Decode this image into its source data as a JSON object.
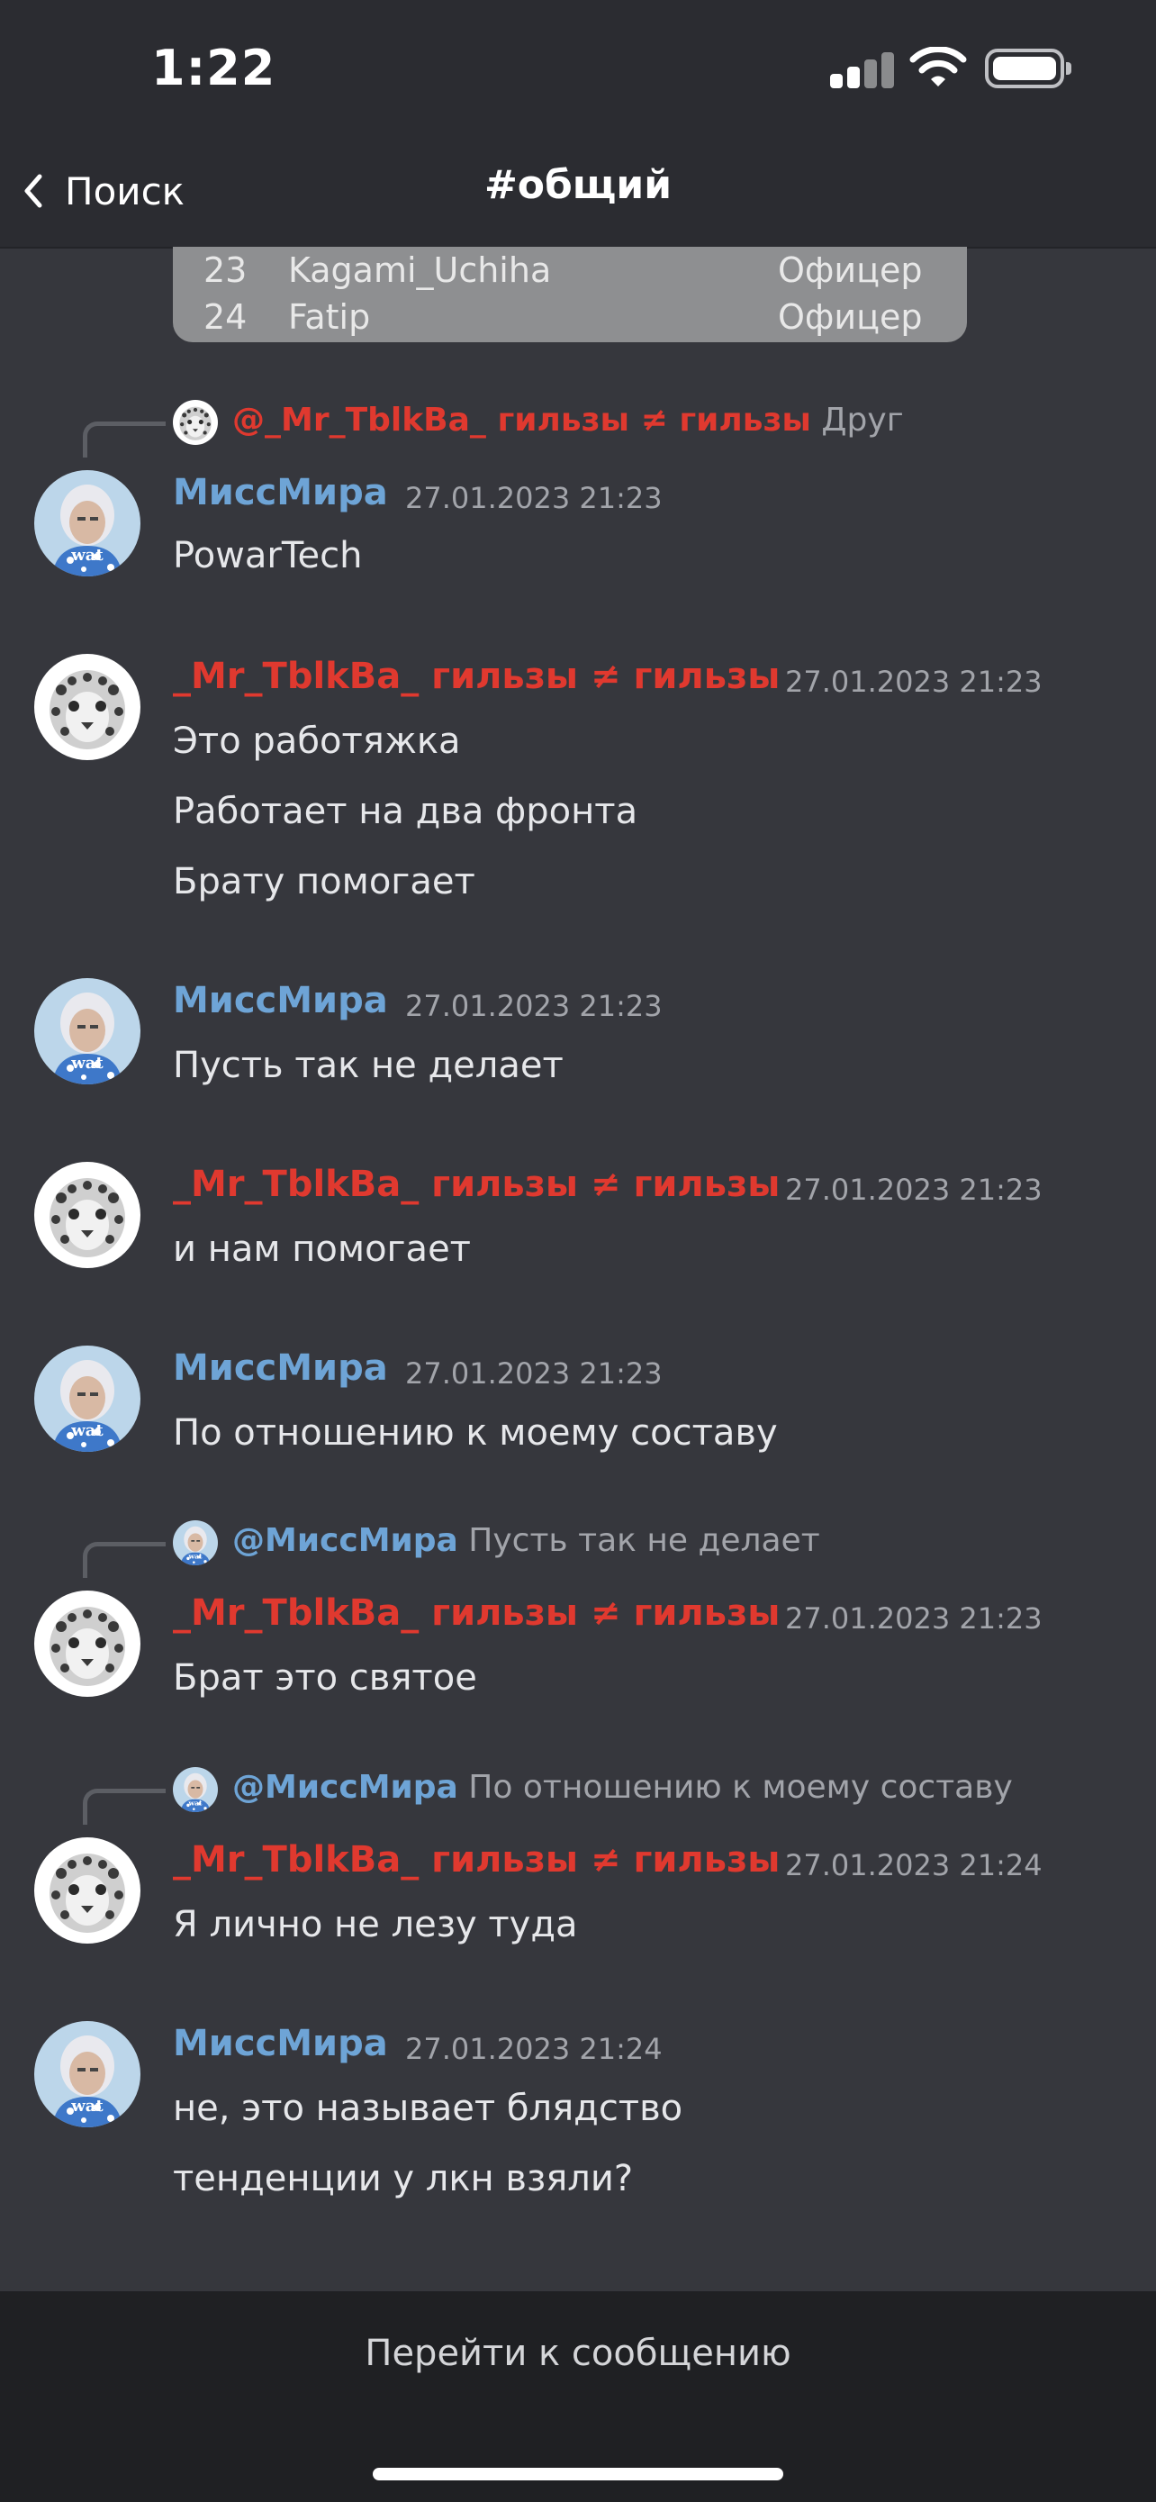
{
  "status": {
    "time": "1:22"
  },
  "nav": {
    "back_label": "Поиск",
    "title": "#общий"
  },
  "table": {
    "rows": [
      {
        "num": "23",
        "name": "Kagami_Uchiha",
        "rank": "Офицер"
      },
      {
        "num": "24",
        "name": "Fatip",
        "rank": "Офицер"
      }
    ]
  },
  "messages": [
    {
      "reply": {
        "name": "@_Mr_TblkBa_ гильзы ≠ гильзы",
        "text": "Друг"
      },
      "author": "МиссМира",
      "time": "27.01.2023 21:23",
      "lines": [
        "PowarTech"
      ]
    },
    {
      "author": "_Mr_TblkBa_ гильзы ≠ гильзы",
      "time": "27.01.2023 21:23",
      "lines": [
        "Это работяжка",
        "Работает на два фронта",
        "Брату помогает"
      ]
    },
    {
      "author": "МиссМира",
      "time": "27.01.2023 21:23",
      "lines": [
        "Пусть так не делает"
      ]
    },
    {
      "author": "_Mr_TblkBa_ гильзы ≠ гильзы",
      "time": "27.01.2023 21:23",
      "lines": [
        "и нам помогает"
      ]
    },
    {
      "author": "МиссМира",
      "time": "27.01.2023 21:23",
      "lines": [
        "По отношению к моему составу"
      ]
    },
    {
      "reply": {
        "name": "@МиссМира",
        "text": "Пусть так не делает"
      },
      "author": "_Mr_TblkBa_ гильзы ≠ гильзы",
      "time": "27.01.2023 21:23",
      "lines": [
        "Брат это святое"
      ]
    },
    {
      "reply": {
        "name": "@МиссМира",
        "text": "По отношению к моему составу"
      },
      "author": "_Mr_TblkBa_ гильзы ≠ гильзы",
      "time": "27.01.2023 21:24",
      "lines": [
        "Я лично не лезу туда"
      ]
    },
    {
      "author": "МиссМира",
      "time": "27.01.2023 21:24",
      "lines": [
        "не, это называет блядство",
        "тенденции у лкн взяли?"
      ]
    }
  ],
  "footer": {
    "jump_label": "Перейти к сообщению"
  },
  "colors": {
    "blue_name": "#6ea4d6",
    "red_name": "#e0392f",
    "background": "#36373d"
  }
}
